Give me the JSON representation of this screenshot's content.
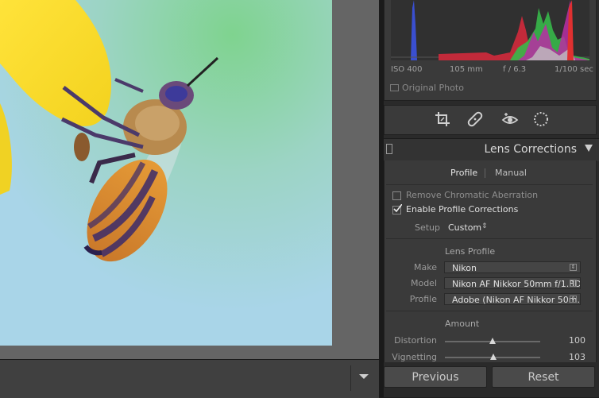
{
  "histogram": {
    "iso": "ISO 400",
    "focal_length": "105 mm",
    "aperture": "f / 6.3",
    "shutter": "1/100 sec",
    "original_photo_label": "Original Photo"
  },
  "lens_corrections": {
    "title": "Lens Corrections",
    "tabs": [
      "Profile",
      "Manual"
    ],
    "remove_ca_label": "Remove Chromatic Aberration",
    "remove_ca_checked": false,
    "enable_profile_label": "Enable Profile Corrections",
    "enable_profile_checked": true,
    "setup_label": "Setup",
    "setup_value": "Custom",
    "lens_profile_title": "Lens Profile",
    "make_label": "Make",
    "make_value": "Nikon",
    "model_label": "Model",
    "model_value": "Nikon AF Nikkor 50mm f/1.8D",
    "profile_label": "Profile",
    "profile_value": "Adobe (Nikon AF Nikkor 50m...",
    "amount_title": "Amount",
    "distortion_label": "Distortion",
    "distortion_value": "100",
    "vignetting_label": "Vignetting",
    "vignetting_value": "103"
  },
  "buttons": {
    "previous": "Previous",
    "reset": "Reset"
  }
}
